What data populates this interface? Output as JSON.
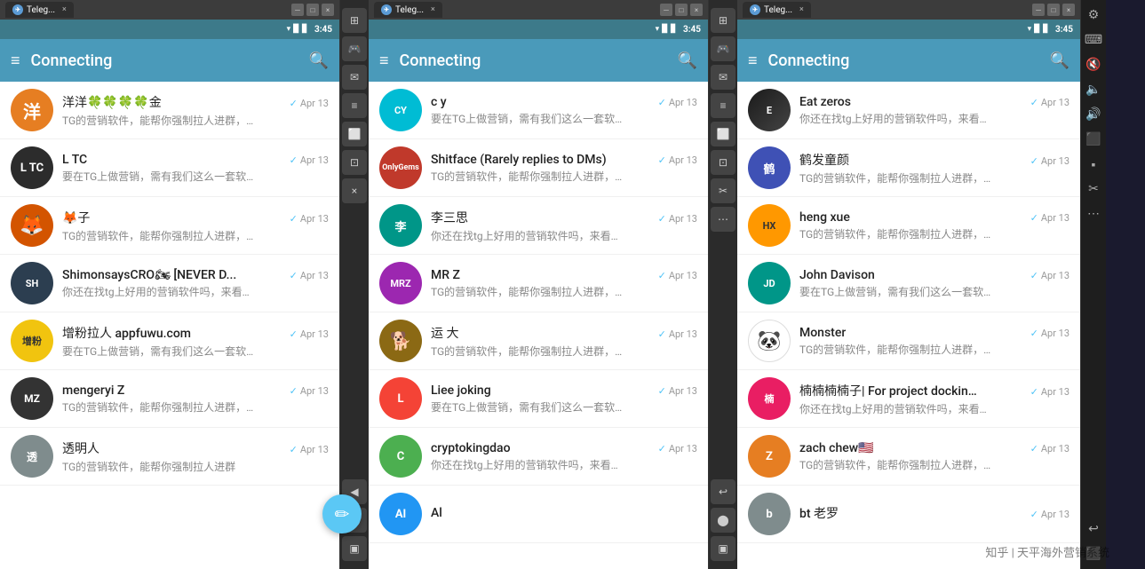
{
  "panels": [
    {
      "id": "panel1",
      "browser": {
        "tab_label": "Teleg...",
        "tab_active": true
      },
      "status_bar": {
        "time": "3:45",
        "wifi": true,
        "battery": true
      },
      "header": {
        "title": "Connecting",
        "menu_icon": "≡",
        "search_icon": "🔍"
      },
      "chats": [
        {
          "id": 1,
          "name": "洋洋🍀🍀🍀🍀金",
          "preview": "TG的营销软件，能帮你强制拉人进群，…",
          "date": "Apr 13",
          "avatar_color": "av-orange",
          "avatar_text": "洋",
          "check": true
        },
        {
          "id": 2,
          "name": "L TC",
          "preview": "要在TG上做营销，需有我们这么一套软…",
          "date": "Apr 13",
          "avatar_color": "av-dark",
          "avatar_text": "L",
          "check": true
        },
        {
          "id": 3,
          "name": "🦊子",
          "preview": "TG的营销软件，能帮你强制拉人进群，…",
          "date": "Apr 13",
          "avatar_color": "av-fox",
          "avatar_text": "🦊",
          "check": true
        },
        {
          "id": 4,
          "name": "ShimonsaysCRO🏍 [NEVER D...",
          "preview": "你还在找tg上好用的营销软件吗，来看…",
          "date": "Apr 13",
          "avatar_color": "av-dark2",
          "avatar_text": "S",
          "check": true
        },
        {
          "id": 5,
          "name": "增粉拉人 appfuwu.com",
          "preview": "要在TG上做营销，需有我们这么一套软…",
          "date": "Apr 13",
          "avatar_color": "av-yellow",
          "avatar_text": "增",
          "check": true
        },
        {
          "id": 6,
          "name": "mengeryi Z",
          "preview": "TG的营销软件，能帮你强制拉人进群，…",
          "date": "Apr 13",
          "avatar_color": "av-dark3",
          "avatar_text": "M",
          "check": true
        },
        {
          "id": 7,
          "name": "透明人",
          "preview": "TG的营销软件，能帮你强制拉人进群",
          "date": "Apr 13",
          "avatar_color": "av-gray",
          "avatar_text": "透",
          "check": true
        }
      ]
    },
    {
      "id": "panel2",
      "browser": {
        "tab_label": "Teleg...",
        "tab_active": true
      },
      "status_bar": {
        "time": "3:45"
      },
      "header": {
        "title": "Connecting",
        "menu_icon": "≡",
        "search_icon": "🔍"
      },
      "chats": [
        {
          "id": 1,
          "name": "c y",
          "preview": "要在TG上做营销，需有我们这么一套软…",
          "date": "Apr 13",
          "avatar_color": "av-cyan",
          "avatar_text": "CY",
          "check": true
        },
        {
          "id": 2,
          "name": "Shitface (Rarely replies to DMs)",
          "preview": "TG的营销软件，能帮你强制拉人进群，…",
          "date": "Apr 13",
          "avatar_color": "av-blue",
          "avatar_text": "OG",
          "check": true,
          "has_image": true
        },
        {
          "id": 3,
          "name": "李三思",
          "preview": "你还在找tg上好用的营销软件吗，来看…",
          "date": "Apr 13",
          "avatar_color": "av-teal",
          "avatar_text": "李",
          "check": true
        },
        {
          "id": 4,
          "name": "MR Z",
          "preview": "TG的营销软件，能帮你强制拉人进群，…",
          "date": "Apr 13",
          "avatar_color": "av-purple",
          "avatar_text": "MZ",
          "check": true
        },
        {
          "id": 5,
          "name": "运 大",
          "preview": "TG的营销软件，能帮你强制拉人进群，…",
          "date": "Apr 13",
          "avatar_color": "av-brown",
          "avatar_text": "运",
          "check": true
        },
        {
          "id": 6,
          "name": "Liee joking",
          "preview": "要在TG上做营销，需有我们这么一套软…",
          "date": "Apr 13",
          "avatar_color": "av-red",
          "avatar_text": "L",
          "check": true
        },
        {
          "id": 7,
          "name": "cryptokingdao",
          "preview": "你还在找tg上好用的营销软件吗，来看…",
          "date": "Apr 13",
          "avatar_color": "av-green",
          "avatar_text": "C",
          "check": true
        },
        {
          "id": 8,
          "name": "Al",
          "preview": "",
          "date": "",
          "avatar_color": "av-blue",
          "avatar_text": "A",
          "check": false
        }
      ]
    },
    {
      "id": "panel3",
      "browser": {
        "tab_label": "Teleg...",
        "tab_active": true
      },
      "status_bar": {
        "time": "3:45"
      },
      "header": {
        "title": "Connecting",
        "menu_icon": "≡",
        "search_icon": "🔍"
      },
      "chats": [
        {
          "id": 1,
          "name": "Eat zeros",
          "preview": "你还在找tg上好用的营销软件吗，来看…",
          "date": "Apr 13",
          "avatar_color": "av-dark2",
          "avatar_text": "E",
          "check": true,
          "has_image": true
        },
        {
          "id": 2,
          "name": "鹤发童颜",
          "preview": "TG的营销软件，能帮你强制拉人进群，…",
          "date": "Apr 13",
          "avatar_color": "av-indigo",
          "avatar_text": "鹤",
          "check": true
        },
        {
          "id": 3,
          "name": "heng xue",
          "preview": "TG的营销软件，能帮你强制拉人进群，…",
          "date": "Apr 13",
          "avatar_color": "av-amber",
          "avatar_text": "HX",
          "check": true
        },
        {
          "id": 4,
          "name": "John Davison",
          "preview": "要在TG上做营销，需有我们这么一套软…",
          "date": "Apr 13",
          "avatar_color": "av-teal",
          "avatar_text": "JD",
          "check": true
        },
        {
          "id": 5,
          "name": "Monster",
          "preview": "TG的营销软件，能帮你强制拉人进群，…",
          "date": "Apr 13",
          "avatar_color": "av-panda",
          "avatar_text": "🐼",
          "check": true
        },
        {
          "id": 6,
          "name": "楠楠楠楠子| For project dockin...",
          "preview": "你还在找tg上好用的营销软件吗，来看…",
          "date": "Apr 13",
          "avatar_color": "av-pink",
          "avatar_text": "楠",
          "check": true
        },
        {
          "id": 7,
          "name": "zach chew🇺🇸",
          "preview": "TG的营销软件，能帮你强制拉人进群，…",
          "date": "Apr 13",
          "avatar_color": "av-orange",
          "avatar_text": "Z",
          "check": true
        },
        {
          "id": 8,
          "name": "bt 老罗",
          "preview": "",
          "date": "Apr 13",
          "avatar_color": "av-gray",
          "avatar_text": "b",
          "check": true
        }
      ]
    }
  ],
  "toolbar": {
    "buttons": [
      "⊞",
      "🎮",
      "✉",
      "≡",
      "⬜",
      "⊡",
      "×"
    ],
    "bottom_buttons": [
      "◀",
      "⬛",
      "×"
    ]
  },
  "right_toolbar": {
    "buttons": [
      "⚙",
      "⌨",
      "🔇",
      "🔈",
      "🔊",
      "⬛",
      "⬛",
      "✂",
      "⬛",
      "↩",
      "⬛"
    ]
  },
  "watermark": "知乎 | 天平海外营销系统"
}
